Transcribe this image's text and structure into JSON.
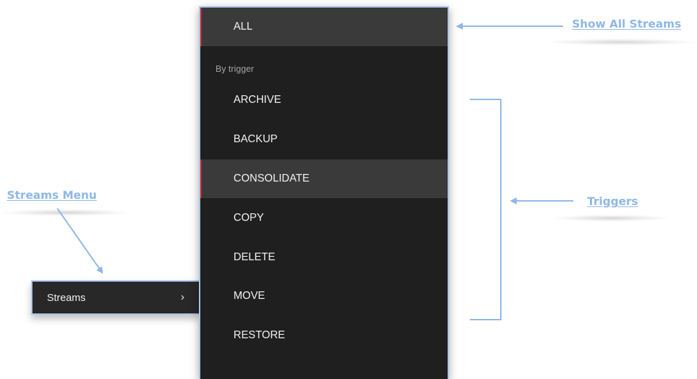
{
  "streams_menu": {
    "label": "Streams",
    "chevron": "›"
  },
  "panel": {
    "all_label": "ALL",
    "section_heading": "By trigger",
    "items": [
      {
        "label": "ARCHIVE",
        "active": false
      },
      {
        "label": "BACKUP",
        "active": false
      },
      {
        "label": "CONSOLIDATE",
        "active": true
      },
      {
        "label": "COPY",
        "active": false
      },
      {
        "label": "DELETE",
        "active": false
      },
      {
        "label": "MOVE",
        "active": false
      },
      {
        "label": "RESTORE",
        "active": false
      }
    ]
  },
  "annotations": {
    "show_all_streams": "Show All Streams",
    "triggers": "Triggers",
    "streams_menu": "Streams Menu"
  },
  "colors": {
    "annotation": "#8eb8e6",
    "panel_bg": "#1f1f1f",
    "active_bg": "#3a3a3a",
    "active_accent": "#c4272b",
    "outline": "#a9c6ea"
  }
}
